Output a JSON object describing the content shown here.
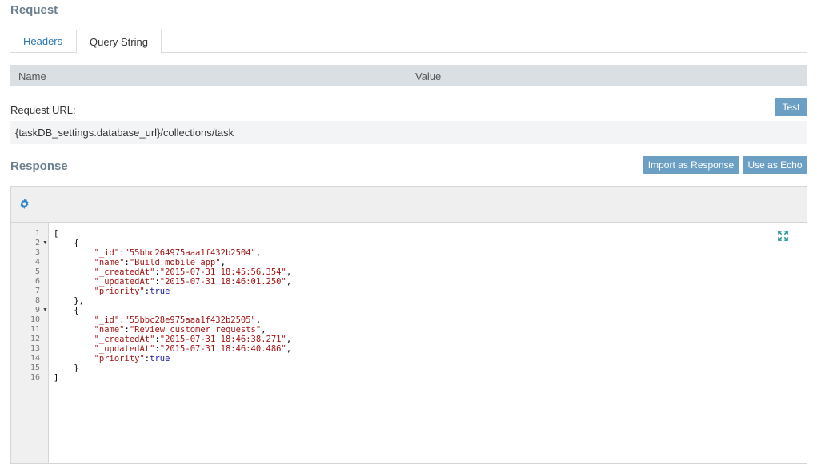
{
  "request": {
    "title": "Request",
    "tabs": [
      {
        "label": "Headers",
        "active": false
      },
      {
        "label": "Query String",
        "active": true
      }
    ],
    "params": {
      "col_name": "Name",
      "col_value": "Value"
    },
    "url_label": "Request URL:",
    "url_value": "{taskDB_settings.database_url}/collections/task",
    "test_label": "Test"
  },
  "response": {
    "title": "Response",
    "import_label": "Import as Response",
    "echo_label": "Use as Echo",
    "toolbar_icon": "gear-icon",
    "expand_icon": "expand-icon",
    "lines": [
      {
        "no": "1",
        "fold": false,
        "indent": "",
        "tokens": [
          [
            "k",
            "["
          ]
        ]
      },
      {
        "no": "2",
        "fold": true,
        "indent": "    ",
        "tokens": [
          [
            "k",
            "{"
          ]
        ]
      },
      {
        "no": "3",
        "fold": false,
        "indent": "        ",
        "tokens": [
          [
            "s",
            "\"_id\""
          ],
          [
            "k",
            ":"
          ],
          [
            "s",
            "\"55bbc264975aaa1f432b2504\""
          ],
          [
            "k",
            ","
          ]
        ]
      },
      {
        "no": "4",
        "fold": false,
        "indent": "        ",
        "tokens": [
          [
            "s",
            "\"name\""
          ],
          [
            "k",
            ":"
          ],
          [
            "s",
            "\"Build mobile app\""
          ],
          [
            "k",
            ","
          ]
        ]
      },
      {
        "no": "5",
        "fold": false,
        "indent": "        ",
        "tokens": [
          [
            "s",
            "\"_createdAt\""
          ],
          [
            "k",
            ":"
          ],
          [
            "s",
            "\"2015-07-31 18:45:56.354\""
          ],
          [
            "k",
            ","
          ]
        ]
      },
      {
        "no": "6",
        "fold": false,
        "indent": "        ",
        "tokens": [
          [
            "s",
            "\"_updatedAt\""
          ],
          [
            "k",
            ":"
          ],
          [
            "s",
            "\"2015-07-31 18:46:01.250\""
          ],
          [
            "k",
            ","
          ]
        ]
      },
      {
        "no": "7",
        "fold": false,
        "indent": "        ",
        "tokens": [
          [
            "s",
            "\"priority\""
          ],
          [
            "k",
            ":"
          ],
          [
            "b",
            "true"
          ]
        ]
      },
      {
        "no": "8",
        "fold": false,
        "indent": "    ",
        "tokens": [
          [
            "k",
            "},"
          ]
        ]
      },
      {
        "no": "9",
        "fold": true,
        "indent": "    ",
        "tokens": [
          [
            "k",
            "{"
          ]
        ]
      },
      {
        "no": "10",
        "fold": false,
        "indent": "        ",
        "tokens": [
          [
            "s",
            "\"_id\""
          ],
          [
            "k",
            ":"
          ],
          [
            "s",
            "\"55bbc28e975aaa1f432b2505\""
          ],
          [
            "k",
            ","
          ]
        ]
      },
      {
        "no": "11",
        "fold": false,
        "indent": "        ",
        "tokens": [
          [
            "s",
            "\"name\""
          ],
          [
            "k",
            ":"
          ],
          [
            "s",
            "\"Review customer requests\""
          ],
          [
            "k",
            ","
          ]
        ]
      },
      {
        "no": "12",
        "fold": false,
        "indent": "        ",
        "tokens": [
          [
            "s",
            "\"_createdAt\""
          ],
          [
            "k",
            ":"
          ],
          [
            "s",
            "\"2015-07-31 18:46:38.271\""
          ],
          [
            "k",
            ","
          ]
        ]
      },
      {
        "no": "13",
        "fold": false,
        "indent": "        ",
        "tokens": [
          [
            "s",
            "\"_updatedAt\""
          ],
          [
            "k",
            ":"
          ],
          [
            "s",
            "\"2015-07-31 18:46:40.486\""
          ],
          [
            "k",
            ","
          ]
        ]
      },
      {
        "no": "14",
        "fold": false,
        "indent": "        ",
        "tokens": [
          [
            "s",
            "\"priority\""
          ],
          [
            "k",
            ":"
          ],
          [
            "b",
            "true"
          ]
        ]
      },
      {
        "no": "15",
        "fold": false,
        "indent": "    ",
        "tokens": [
          [
            "k",
            "}"
          ]
        ]
      },
      {
        "no": "16",
        "fold": false,
        "indent": "",
        "tokens": [
          [
            "k",
            "]"
          ]
        ]
      }
    ]
  },
  "colors": {
    "accent": "#2a7ab8",
    "button": "#6b9fc3",
    "title": "#6b7f8e",
    "string": "#a31515",
    "boolean": "#1a1aa6"
  }
}
